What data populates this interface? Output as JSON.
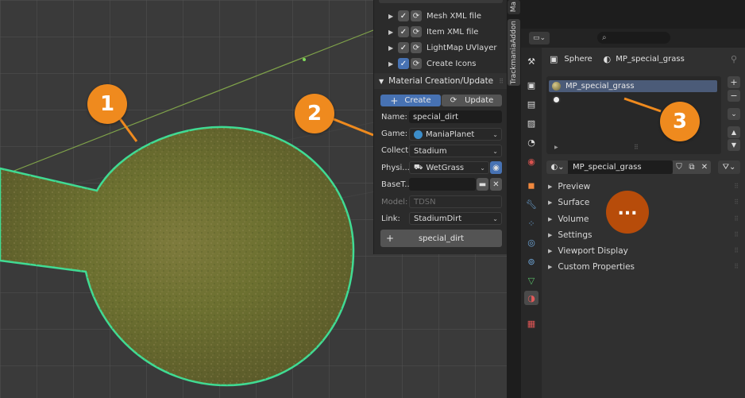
{
  "callouts": {
    "one": "1",
    "two": "2",
    "three": "3",
    "dots": "..."
  },
  "addon": {
    "export_rows": [
      {
        "label": "Mesh XML file",
        "checked": true
      },
      {
        "label": "Item XML file",
        "checked": true
      },
      {
        "label": "LightMap UVlayer",
        "checked": true
      },
      {
        "label": "Create Icons",
        "checked": true
      }
    ],
    "section_title": "Material Creation/Update",
    "create_label": "Create",
    "update_label": "Update",
    "name_label": "Name:",
    "name_value": "special_dirt",
    "game_label": "Game:",
    "game_value": "ManiaPlanet",
    "collection_label": "Collect...",
    "collection_value": "Stadium",
    "physics_label": "Physi...",
    "physics_value": "WetGrass",
    "basetexture_label": "BaseT...",
    "basetexture_value": "",
    "model_label": "Model:",
    "model_value": "TDSN",
    "link_label": "Link:",
    "link_value": "StadiumDirt",
    "add_material_label": "special_dirt",
    "tab_label": "TrackmaniaAddon",
    "top_tab_label": "Ma"
  },
  "props": {
    "search_placeholder": "",
    "breadcrumb_object": "Sphere",
    "breadcrumb_material": "MP_special_grass",
    "material_slots": [
      "MP_special_grass",
      ""
    ],
    "material_name": "MP_special_grass",
    "panels": [
      "Preview",
      "Surface",
      "Volume",
      "Settings",
      "Viewport Display",
      "Custom Properties"
    ]
  },
  "colors": {
    "accent_orange": "#ef8a1e",
    "dots_orange": "#b74c0a",
    "selection_outline": "#3fdc94",
    "blender_blue": "#4772b3"
  }
}
